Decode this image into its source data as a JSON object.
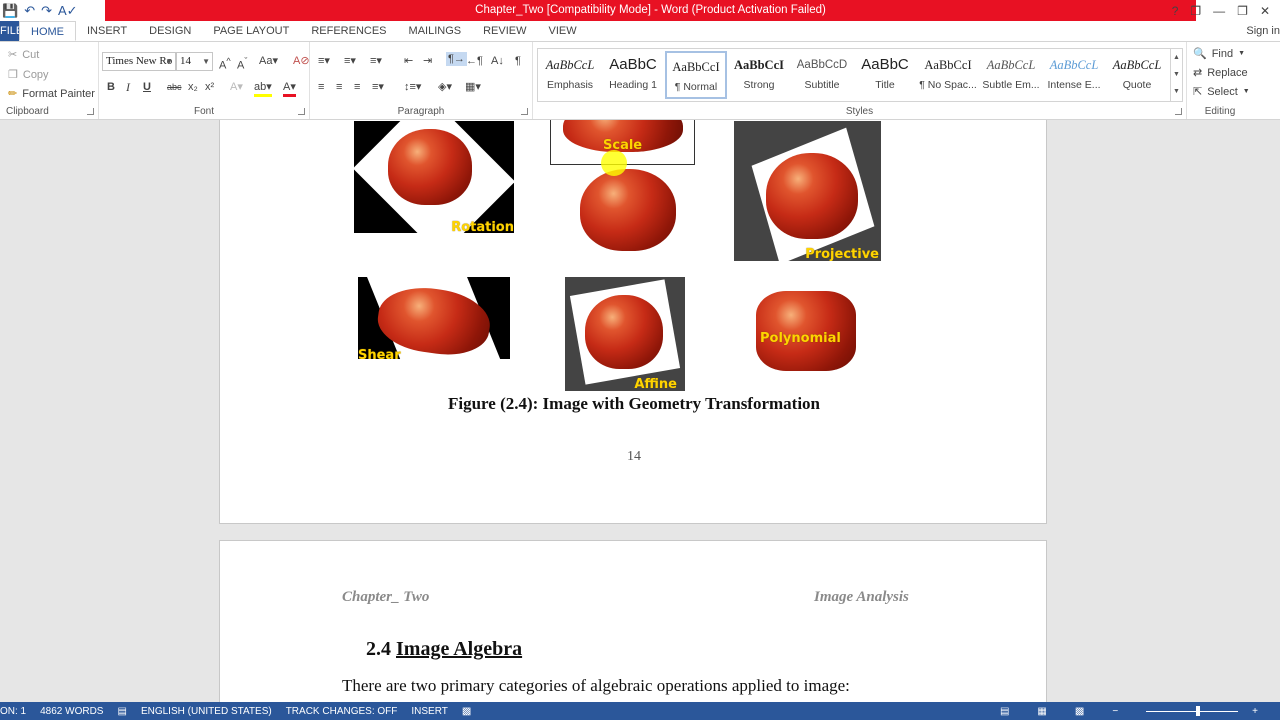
{
  "window": {
    "title": "Chapter_Two [Compatibility Mode] - Word (Product Activation Failed)",
    "controls": [
      "?",
      "❐",
      "—",
      "❐",
      "✕"
    ],
    "sign_in": "Sign in"
  },
  "tabs": {
    "file": "FILE",
    "items": [
      "HOME",
      "INSERT",
      "DESIGN",
      "PAGE LAYOUT",
      "REFERENCES",
      "MAILINGS",
      "REVIEW",
      "VIEW"
    ],
    "active": "HOME"
  },
  "clipboard": {
    "cut": "Cut",
    "copy": "Copy",
    "format_painter": "Format Painter",
    "label": "Clipboard"
  },
  "font": {
    "family": "Times New Ro",
    "size": "14",
    "label": "Font",
    "buttons": [
      "B",
      "I",
      "U",
      "abc",
      "x₂",
      "x²"
    ]
  },
  "paragraph": {
    "label": "Paragraph"
  },
  "styles": {
    "label": "Styles",
    "items": [
      {
        "preview": "AaBbCcL",
        "name": "Emphasis"
      },
      {
        "preview": "AaBbC",
        "name": "Heading 1"
      },
      {
        "preview": "AaBbCcI",
        "name": "¶ Normal"
      },
      {
        "preview": "AaBbCcI",
        "name": "Strong"
      },
      {
        "preview": "AaBbCcD",
        "name": "Subtitle"
      },
      {
        "preview": "AaBbC",
        "name": "Title"
      },
      {
        "preview": "AaBbCcI",
        "name": "¶ No Spac..."
      },
      {
        "preview": "AaBbCcL",
        "name": "Subtle Em..."
      },
      {
        "preview": "AaBbCcL",
        "name": "Intense E..."
      },
      {
        "preview": "AaBbCcL",
        "name": "Quote"
      }
    ],
    "selected_index": 2
  },
  "editing": {
    "find": "Find",
    "replace": "Replace",
    "select": "Select",
    "label": "Editing"
  },
  "document": {
    "figure_labels": {
      "rotation": "Rotation",
      "scale": "Scale",
      "projective": "Projective",
      "shear": "Shear",
      "affine": "Affine",
      "polynomial": "Polynomial"
    },
    "caption": "Figure (2.4): Image with Geometry Transformation",
    "page_number": "14",
    "header_left": "Chapter_ Two",
    "header_right": "Image Analysis",
    "section_number": "2.4",
    "section_title": "Image Algebra",
    "body_line": "There are two primary categories of algebraic operations applied to image:"
  },
  "status": {
    "page": "ON: 1",
    "words": "4862 WORDS",
    "language": "ENGLISH (UNITED STATES)",
    "track_changes": "TRACK CHANGES: OFF",
    "mode": "INSERT"
  },
  "colors": {
    "accent": "#2b579a",
    "title_bar_alert": "#e81123",
    "label_yellow": "#ffd400"
  }
}
